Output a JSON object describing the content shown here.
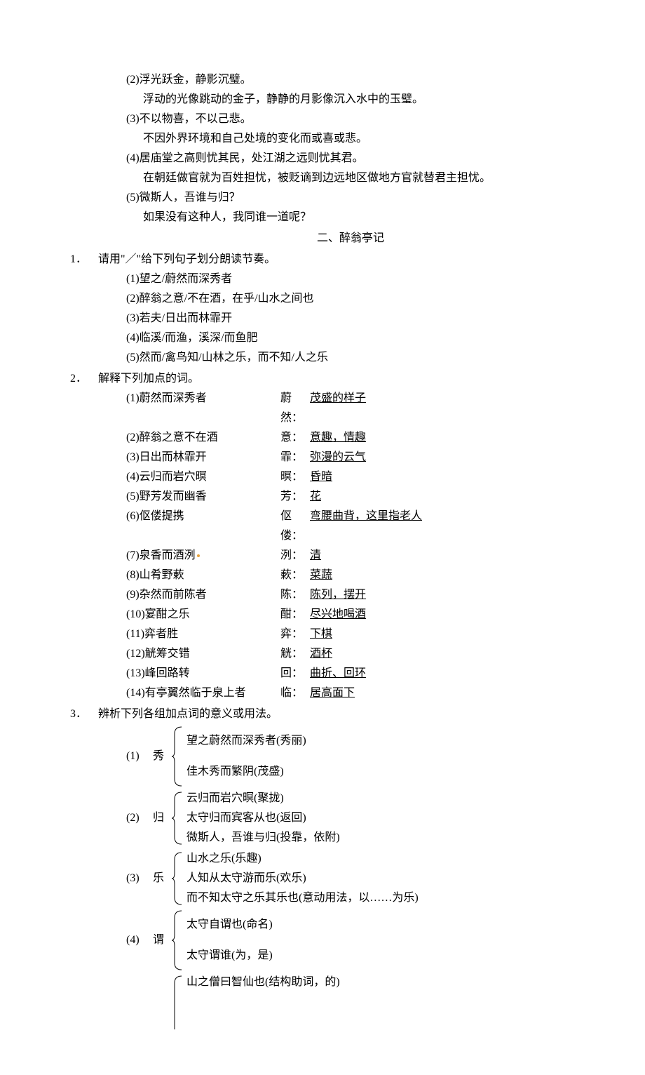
{
  "top_items": [
    {
      "num": "(2)",
      "orig": "浮光跃金，静影沉璧。",
      "trans": "浮动的光像跳动的金子，静静的月影像沉入水中的玉璧。"
    },
    {
      "num": "(3)",
      "orig": "不以物喜，不以己悲。",
      "trans": "不因外界环境和自己处境的变化而或喜或悲。"
    },
    {
      "num": "(4)",
      "orig": "居庙堂之高则忧其民，处江湖之远则忧其君。",
      "trans": "在朝廷做官就为百姓担忧，被贬谪到边远地区做地方官就替君主担忧。"
    },
    {
      "num": "(5)",
      "orig": "微斯人，吾谁与归？",
      "trans": "如果没有这种人，我同谁一道呢？"
    }
  ],
  "section_title": "二、醉翁亭记",
  "q1": {
    "stem": "请用\"／\"给下列句子划分朗读节奏。",
    "items": [
      {
        "num": "(1)",
        "text": "望之/蔚然而深秀者"
      },
      {
        "num": "(2)",
        "text": "醉翁之意/不在酒，在乎/山水之间也"
      },
      {
        "num": "(3)",
        "text": "若夫/日出而林霏开"
      },
      {
        "num": "(4)",
        "text": "临溪/而渔，溪深/而鱼肥"
      },
      {
        "num": "(5)",
        "text": "然而/禽鸟知/山林之乐，而不知/人之乐"
      }
    ]
  },
  "q2": {
    "stem": "解释下列加点的词。",
    "items": [
      {
        "num": "(1)",
        "term": "蔚然而深秀者",
        "label": "蔚然：",
        "val": "茂盛的样子"
      },
      {
        "num": "(2)",
        "term": "醉翁之意不在酒",
        "label": "意：",
        "val": "意趣，情趣"
      },
      {
        "num": "(3)",
        "term": "日出而林霏开",
        "label": "霏：",
        "val": "弥漫的云气"
      },
      {
        "num": "(4)",
        "term": "云归而岩穴暝",
        "label": "暝：",
        "val": "昏暗"
      },
      {
        "num": "(5)",
        "term": "野芳发而幽香",
        "label": "芳：",
        "val": "花"
      },
      {
        "num": "(6)",
        "term": "伛偻提携",
        "label": "伛偻：",
        "val": "弯腰曲背，这里指老人"
      },
      {
        "num": "(7)",
        "term": "泉香而酒洌",
        "label": "洌：",
        "val": "清",
        "dot": true
      },
      {
        "num": "(8)",
        "term": "山肴野蔌",
        "label": "蔌：",
        "val": "菜蔬"
      },
      {
        "num": "(9)",
        "term": "杂然而前陈者",
        "label": "陈：",
        "val": "陈列，摆开"
      },
      {
        "num": "(10)",
        "term": "宴酣之乐",
        "label": "酣：",
        "val": "尽兴地喝酒"
      },
      {
        "num": "(11)",
        "term": "弈者胜",
        "label": "弈：",
        "val": "下棋"
      },
      {
        "num": "(12)",
        "term": "觥筹交错",
        "label": "觥：",
        "val": "酒杯"
      },
      {
        "num": "(13)",
        "term": "峰回路转",
        "label": "回：",
        "val": "曲折、回环"
      },
      {
        "num": "(14)",
        "term": "有亭翼然临于泉上者",
        "label": "临：",
        "val": "居高面下"
      }
    ]
  },
  "q3": {
    "stem": "辨析下列各组加点词的意义或用法。",
    "groups": [
      {
        "num": "(1)",
        "key": "秀",
        "lines": [
          "望之蔚然而深秀者(秀丽)",
          "佳木秀而繁阴(茂盛)"
        ],
        "spaced": true
      },
      {
        "num": "(2)",
        "key": "归",
        "lines": [
          "云归而岩穴暝(聚拢)",
          "太守归而宾客从也(返回)",
          "微斯人，吾谁与归(投靠，依附)"
        ]
      },
      {
        "num": "(3)",
        "key": "乐",
        "lines": [
          "山水之乐(乐趣)",
          "人知从太守游而乐(欢乐)",
          "而不知太守之乐其乐也(意动用法，以……为乐)"
        ]
      },
      {
        "num": "(4)",
        "key": "谓",
        "lines": [
          "太守自谓也(命名)",
          "太守谓谁(为，是)"
        ],
        "spaced": true
      },
      {
        "num": "",
        "key": "",
        "lines": [
          "山之僧曰智仙也(结构助词，的)",
          "",
          ""
        ],
        "open": true
      }
    ]
  }
}
